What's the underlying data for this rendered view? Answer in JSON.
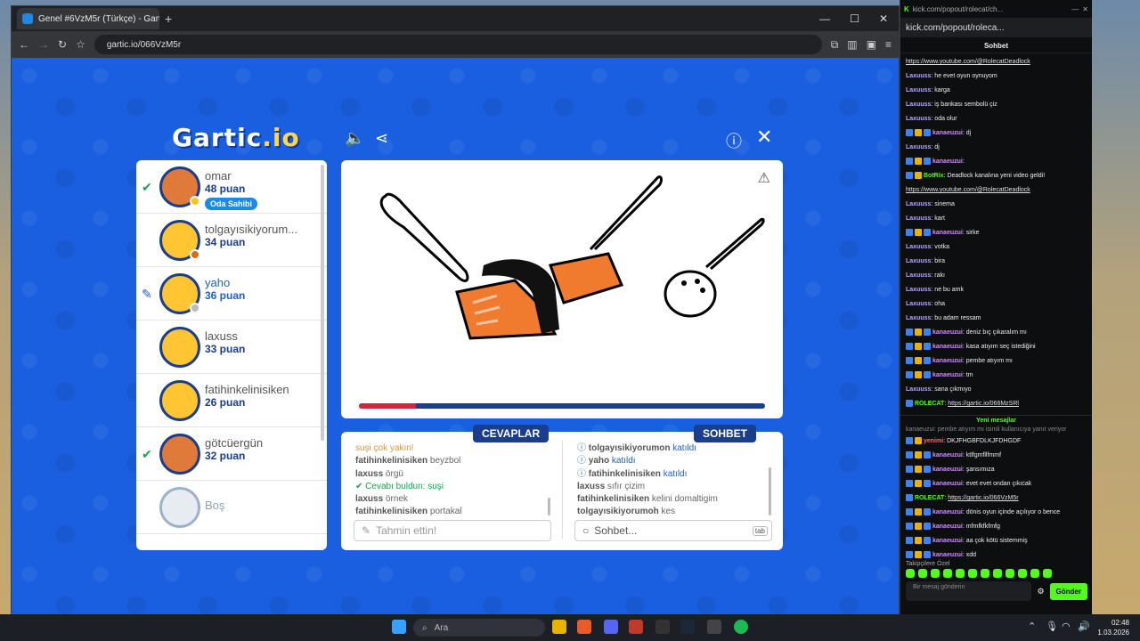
{
  "browser": {
    "tab_title": "Genel #6VzM5r (Türkçe) - Gartic",
    "url": "gartic.io/066VzM5r"
  },
  "game": {
    "logo_main": "Gartic",
    "logo_suffix": ".io",
    "players": [
      {
        "name": "omar",
        "points": "48 puan",
        "owner_badge": "Oda Sahibi",
        "mark": "✔",
        "dot_color": "#f5c518"
      },
      {
        "name": "tolgayısikiyorum...",
        "points": "34 puan",
        "mark": "",
        "dot_color": "#d86a1c"
      },
      {
        "name": "yaho",
        "points": "36 puan",
        "mark": "✎",
        "dot_color": "#bbbbbb"
      },
      {
        "name": "laxuss",
        "points": "33 puan",
        "mark": "",
        "dot_color": ""
      },
      {
        "name": "fatihinkelinisiken",
        "points": "26 puan",
        "mark": "",
        "dot_color": ""
      },
      {
        "name": "götcüergün",
        "points": "32 puan",
        "mark": "✔",
        "dot_color": ""
      },
      {
        "name": "Boş",
        "points": "",
        "mark": "",
        "dot_color": ""
      }
    ],
    "progress_fraction": 0.14,
    "answers_title": "CEVAPLAR",
    "chat_title": "SOHBET",
    "answers": [
      {
        "user": "",
        "text": "suşi çok yakın!",
        "kind": "near"
      },
      {
        "user": "fatihinkelinisiken",
        "text": "beyzbol",
        "kind": "plain"
      },
      {
        "user": "laxuss",
        "text": "örgü",
        "kind": "plain"
      },
      {
        "user": "",
        "text": "Cevabı buldun: suşi",
        "kind": "ok"
      },
      {
        "user": "laxuss",
        "text": "örnek",
        "kind": "plain"
      },
      {
        "user": "fatihinkelinisiken",
        "text": "portakal",
        "kind": "plain"
      }
    ],
    "chat": [
      {
        "user": "tolgayısikiyorumon",
        "text": "katıldı",
        "kind": "info"
      },
      {
        "user": "yaho",
        "text": "katıldı",
        "kind": "info"
      },
      {
        "user": "fatihinkelinisiken",
        "text": "katıldı",
        "kind": "info"
      },
      {
        "user": "laxuss",
        "text": "sıfır çizim",
        "kind": "plain"
      },
      {
        "user": "fatihinkelinisiken",
        "text": "kelini domaltigim",
        "kind": "plain"
      },
      {
        "user": "tolgayısikiyorumoh",
        "text": "kes",
        "kind": "plain"
      }
    ],
    "guess_placeholder": "Tahmin ettin!",
    "chat_placeholder": "Sohbet...",
    "chat_shortcut": "tab"
  },
  "kick": {
    "url": "kick.com/popout/rolecat/ch...",
    "addr": "kick.com/popout/rolecа...",
    "header": "Sohbet",
    "messages": [
      {
        "user": "",
        "text": "https://www.youtube.com/@RolecatDeadlock",
        "style": "link",
        "badges": 0
      },
      {
        "user": "Laxuuss",
        "text": "he evet oyun oynuyom",
        "style": "u",
        "badges": 0
      },
      {
        "user": "Laxuuss",
        "text": "karga",
        "style": "u",
        "badges": 0
      },
      {
        "user": "Laxuuss",
        "text": "iş bankası sembolü çiz",
        "style": "u",
        "badges": 0
      },
      {
        "user": "Laxuuss",
        "text": "oda olur",
        "style": "u",
        "badges": 0
      },
      {
        "user": "kanaeuzui",
        "text": "dj",
        "style": "p",
        "badges": 3
      },
      {
        "user": "Laxuuss",
        "text": "dj",
        "style": "u",
        "badges": 0
      },
      {
        "user": "kanaeuzui",
        "text": "",
        "style": "p",
        "badges": 3
      },
      {
        "user": "BotRix",
        "text": "Deadlock kanalına yeni video geldi!",
        "style": "g",
        "badges": 2
      },
      {
        "user": "",
        "text": "https://www.youtube.com/@RolecatDeadlock",
        "style": "link",
        "badges": 0
      },
      {
        "user": "Laxuuss",
        "text": "sinema",
        "style": "u",
        "badges": 0
      },
      {
        "user": "Laxuuss",
        "text": "kart",
        "style": "u",
        "badges": 0
      },
      {
        "user": "kanaeuzui",
        "text": "sirke",
        "style": "p",
        "badges": 3
      },
      {
        "user": "Laxuuss",
        "text": "votka",
        "style": "u",
        "badges": 0
      },
      {
        "user": "Laxuuss",
        "text": "bira",
        "style": "u",
        "badges": 0
      },
      {
        "user": "Laxuuss",
        "text": "rakı",
        "style": "u",
        "badges": 0
      },
      {
        "user": "Laxuuss",
        "text": "ne bu amk",
        "style": "u",
        "badges": 0
      },
      {
        "user": "Laxuuss",
        "text": "oha",
        "style": "u",
        "badges": 0
      },
      {
        "user": "Laxuuss",
        "text": "bu adam ressam",
        "style": "u",
        "badges": 0
      },
      {
        "user": "kanaeuzui",
        "text": "deniz bıç çıkaralım mı",
        "style": "p",
        "badges": 3
      },
      {
        "user": "kanaeuzui",
        "text": "kasa atıyım seç istediğini",
        "style": "p",
        "badges": 3
      },
      {
        "user": "kanaeuzui",
        "text": "pembe atıyım mı",
        "style": "p",
        "badges": 3
      },
      {
        "user": "kanaeuzui",
        "text": "tm",
        "style": "p",
        "badges": 3
      },
      {
        "user": "Laxuuss",
        "text": "sana çıkmıyo",
        "style": "u",
        "badges": 0
      },
      {
        "user": "ROLECAT",
        "text": "https://gartic.io/066MzSRl",
        "style": "g",
        "badges": 1
      }
    ],
    "new_messages_label": "Yeni mesajlar",
    "reply_note": "kanaeuzui: pembe atıyım mı isimli kullanıcıya yanıt veriyor",
    "new_messages": [
      {
        "user": "yenimi",
        "text": "DKJFHGBFDLKJFDHGDF",
        "style": "r",
        "badges": 2
      },
      {
        "user": "kanaeuzui",
        "text": "ktlfgmfllfmmf",
        "style": "p",
        "badges": 3
      },
      {
        "user": "kanaeuzui",
        "text": "şansımıza",
        "style": "p",
        "badges": 3
      },
      {
        "user": "kanaeuzui",
        "text": "evet evet ondan çıkıcak",
        "style": "p",
        "badges": 3
      },
      {
        "user": "ROLECAT",
        "text": "https://gartic.io/066VzM5r",
        "style": "g",
        "badges": 1
      },
      {
        "user": "kanaeuzui",
        "text": "dönis oyun içinde açılıyor o bence",
        "style": "p",
        "badges": 3
      },
      {
        "user": "kanaeuzui",
        "text": "mfmfkfkfmfg",
        "style": "p",
        "badges": 3
      },
      {
        "user": "kanaeuzui",
        "text": "aa çok kötü sistemmiş",
        "style": "p",
        "badges": 3
      },
      {
        "user": "kanaeuzui",
        "text": "xdd",
        "style": "p",
        "badges": 3
      }
    ],
    "followers_label": "Takipçilere Özel",
    "input_placeholder": "Bir mesaj gönderin",
    "send_label": "Gönder"
  },
  "taskbar": {
    "search": "Ara",
    "time": "02:48",
    "date": "1.03.2026"
  },
  "colors": {
    "page_bg": "#1a5fe0",
    "nav": "#1a3e8a",
    "kick_green": "#53fc18",
    "progress": "#d0283a"
  }
}
